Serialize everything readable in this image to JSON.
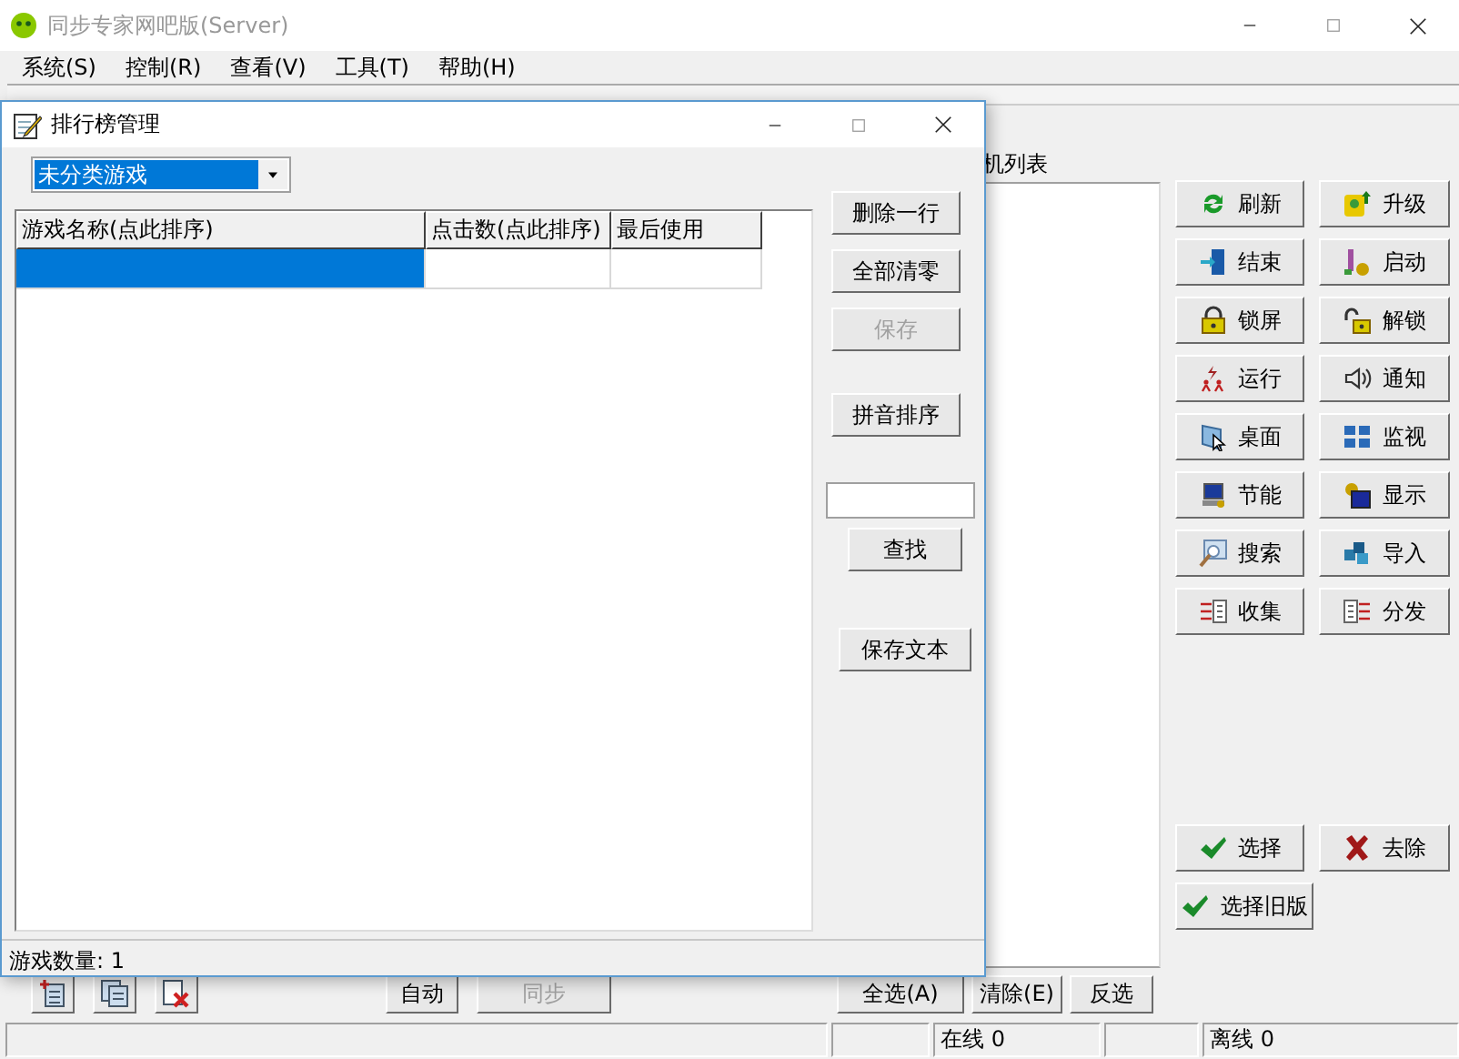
{
  "window": {
    "title": "同步专家网吧版(Server)"
  },
  "menu": [
    {
      "label": "系统(S)"
    },
    {
      "label": "控制(R)"
    },
    {
      "label": "查看(V)"
    },
    {
      "label": "工具(T)"
    },
    {
      "label": "帮助(H)"
    }
  ],
  "client_list": {
    "label": "机列表"
  },
  "action_buttons": [
    {
      "label": "刷新"
    },
    {
      "label": "升级"
    },
    {
      "label": "结束"
    },
    {
      "label": "启动"
    },
    {
      "label": "锁屏"
    },
    {
      "label": "解锁"
    },
    {
      "label": "运行"
    },
    {
      "label": "通知"
    },
    {
      "label": "桌面"
    },
    {
      "label": "监视"
    },
    {
      "label": "节能"
    },
    {
      "label": "显示"
    },
    {
      "label": "搜索"
    },
    {
      "label": "导入"
    },
    {
      "label": "收集"
    },
    {
      "label": "分发"
    }
  ],
  "select_buttons": [
    {
      "label": "选择"
    },
    {
      "label": "去除"
    },
    {
      "label": "选择旧版"
    }
  ],
  "bottom_buttons": [
    {
      "label": "自动",
      "disabled": false
    },
    {
      "label": "同步",
      "disabled": true
    },
    {
      "label": "全选(A)",
      "disabled": false
    },
    {
      "label": "清除(E)",
      "disabled": false
    },
    {
      "label": "反选",
      "disabled": false
    }
  ],
  "status_bar": [
    {
      "text": "在线 0"
    },
    {
      "text": "离线 0"
    }
  ],
  "dialog": {
    "title": "排行榜管理",
    "category": {
      "value": "未分类游戏"
    },
    "table": {
      "columns": [
        "游戏名称(点此排序)",
        "点击数(点此排序)",
        "最后使用"
      ],
      "rows": [
        {
          "selected": true
        }
      ]
    },
    "buttons": [
      {
        "label": "删除一行",
        "disabled": false
      },
      {
        "label": "全部清零",
        "disabled": false
      },
      {
        "label": "保存",
        "disabled": true
      },
      {
        "label": "拼音排序",
        "disabled": false
      },
      {
        "label": "查找",
        "disabled": false
      },
      {
        "label": "保存文本",
        "disabled": false
      }
    ],
    "status": "游戏数量: 1"
  }
}
